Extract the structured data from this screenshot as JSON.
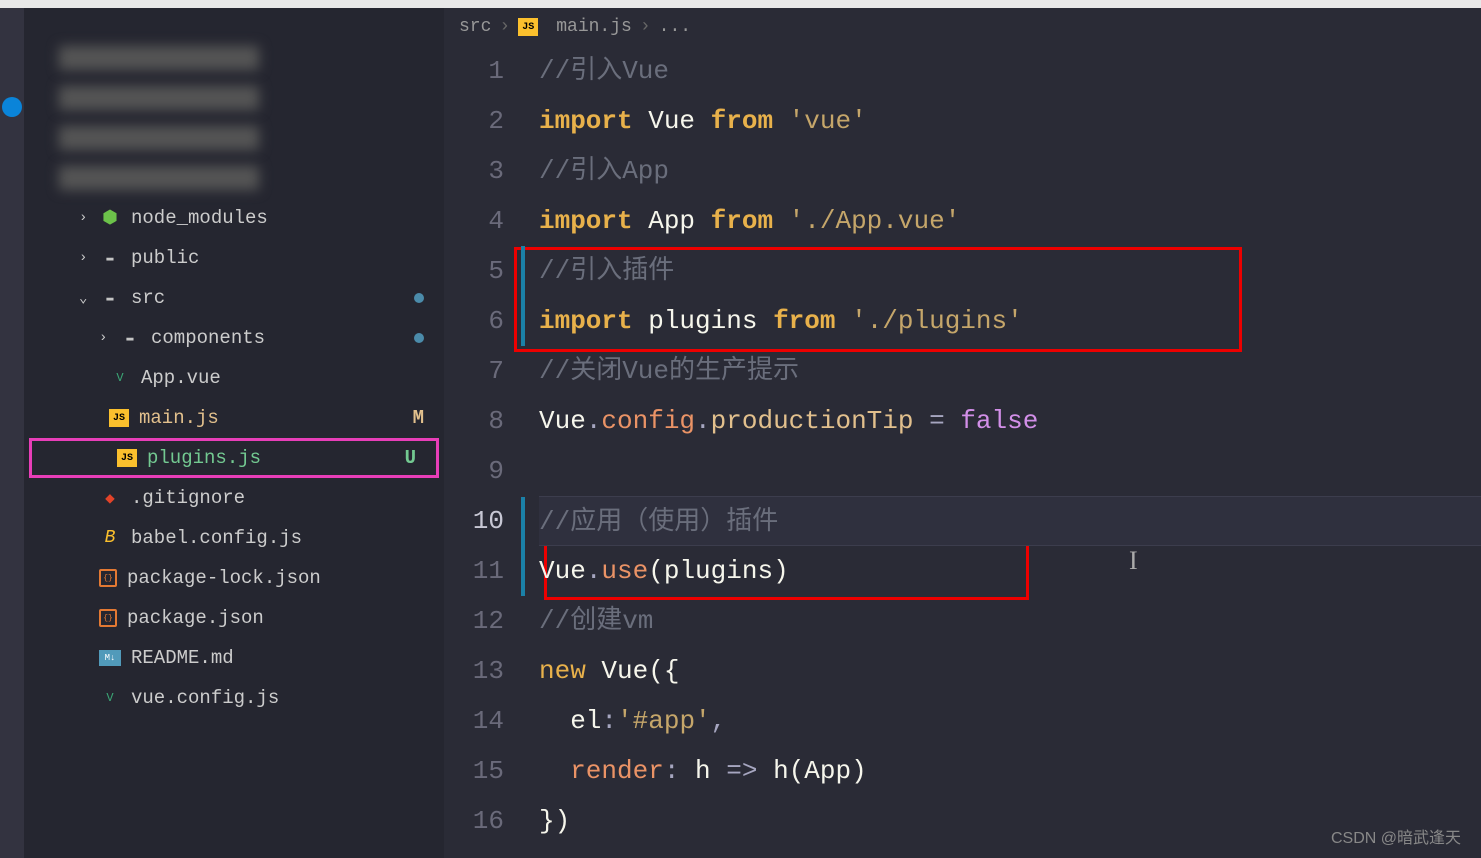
{
  "breadcrumb": {
    "part1": "src",
    "part2": "main.js",
    "part3": "...",
    "icon_label": "JS"
  },
  "sidebar": {
    "items": [
      {
        "type": "blurred"
      },
      {
        "type": "blurred"
      },
      {
        "type": "blurred"
      },
      {
        "type": "blurred"
      },
      {
        "type": "folder",
        "name": "node_modules",
        "chevron": "›",
        "icon": "nodejs",
        "indent": 1
      },
      {
        "type": "folder",
        "name": "public",
        "chevron": "›",
        "icon": "folder",
        "indent": 1
      },
      {
        "type": "folder",
        "name": "src",
        "chevron": "⌄",
        "icon": "folder",
        "indent": 1,
        "modified": true
      },
      {
        "type": "folder",
        "name": "components",
        "chevron": "›",
        "icon": "folder",
        "indent": 2,
        "modified": true
      },
      {
        "type": "file",
        "name": "App.vue",
        "icon": "vue",
        "indent": 3
      },
      {
        "type": "file",
        "name": "main.js",
        "icon": "js",
        "indent": 3,
        "git": "M",
        "git_class": "status-M"
      },
      {
        "type": "file",
        "name": "plugins.js",
        "icon": "js",
        "indent": 3,
        "git": "U",
        "git_class": "status-U",
        "highlight": true
      },
      {
        "type": "file",
        "name": ".gitignore",
        "icon": "git",
        "indent": 2
      },
      {
        "type": "file",
        "name": "babel.config.js",
        "icon": "babel",
        "indent": 2
      },
      {
        "type": "file",
        "name": "package-lock.json",
        "icon": "json",
        "indent": 2
      },
      {
        "type": "file",
        "name": "package.json",
        "icon": "json",
        "indent": 2
      },
      {
        "type": "file",
        "name": "README.md",
        "icon": "md",
        "indent": 2
      },
      {
        "type": "file",
        "name": "vue.config.js",
        "icon": "vue",
        "indent": 2
      }
    ]
  },
  "code": {
    "lines": [
      {
        "num": "1",
        "tokens": [
          {
            "cls": "tk-comment",
            "t": "//引入Vue"
          }
        ]
      },
      {
        "num": "2",
        "tokens": [
          {
            "cls": "tk-keyword",
            "t": "import"
          },
          {
            "cls": "tk-ident",
            "t": " Vue "
          },
          {
            "cls": "tk-from",
            "t": "from"
          },
          {
            "cls": "tk-string",
            "t": " 'vue'"
          }
        ]
      },
      {
        "num": "3",
        "tokens": [
          {
            "cls": "tk-comment",
            "t": "//引入App"
          }
        ]
      },
      {
        "num": "4",
        "tokens": [
          {
            "cls": "tk-keyword",
            "t": "import"
          },
          {
            "cls": "tk-ident",
            "t": " App "
          },
          {
            "cls": "tk-from",
            "t": "from"
          },
          {
            "cls": "tk-string",
            "t": " './App.vue'"
          }
        ]
      },
      {
        "num": "5",
        "tokens": [
          {
            "cls": "tk-comment",
            "t": "//引入插件"
          }
        ],
        "modified": true
      },
      {
        "num": "6",
        "tokens": [
          {
            "cls": "tk-keyword",
            "t": "import"
          },
          {
            "cls": "tk-ident",
            "t": " plugins "
          },
          {
            "cls": "tk-from",
            "t": "from"
          },
          {
            "cls": "tk-string",
            "t": " './plugins'"
          }
        ],
        "modified": true
      },
      {
        "num": "7",
        "tokens": [
          {
            "cls": "tk-comment",
            "t": "//关闭Vue的生产提示"
          }
        ]
      },
      {
        "num": "8",
        "tokens": [
          {
            "cls": "tk-ident",
            "t": "Vue"
          },
          {
            "cls": "tk-op",
            "t": "."
          },
          {
            "cls": "tk-prop",
            "t": "config"
          },
          {
            "cls": "tk-op",
            "t": "."
          },
          {
            "cls": "tk-prop2",
            "t": "productionTip"
          },
          {
            "cls": "tk-op",
            "t": " = "
          },
          {
            "cls": "tk-false",
            "t": "false"
          }
        ]
      },
      {
        "num": "9",
        "tokens": []
      },
      {
        "num": "10",
        "tokens": [
          {
            "cls": "tk-comment",
            "t": "//应用（使用）插件"
          }
        ],
        "current": true,
        "modified": true
      },
      {
        "num": "11",
        "tokens": [
          {
            "cls": "tk-ident",
            "t": "Vue"
          },
          {
            "cls": "tk-op",
            "t": "."
          },
          {
            "cls": "tk-prop",
            "t": "use"
          },
          {
            "cls": "tk-paren",
            "t": "("
          },
          {
            "cls": "tk-ident",
            "t": "plugins"
          },
          {
            "cls": "tk-paren",
            "t": ")"
          }
        ],
        "modified": true
      },
      {
        "num": "12",
        "tokens": [
          {
            "cls": "tk-comment",
            "t": "//创建vm"
          }
        ]
      },
      {
        "num": "13",
        "tokens": [
          {
            "cls": "tk-new",
            "t": "new"
          },
          {
            "cls": "tk-ident",
            "t": " Vue"
          },
          {
            "cls": "tk-paren",
            "t": "({"
          }
        ]
      },
      {
        "num": "14",
        "tokens": [
          {
            "cls": "tk-ident",
            "t": "  el"
          },
          {
            "cls": "tk-op",
            "t": ":"
          },
          {
            "cls": "tk-string",
            "t": "'#app'"
          },
          {
            "cls": "tk-op",
            "t": ","
          }
        ]
      },
      {
        "num": "15",
        "tokens": [
          {
            "cls": "tk-prop",
            "t": "  render"
          },
          {
            "cls": "tk-op",
            "t": ": "
          },
          {
            "cls": "tk-ident",
            "t": "h"
          },
          {
            "cls": "tk-arrow",
            "t": " => "
          },
          {
            "cls": "tk-ident",
            "t": "h"
          },
          {
            "cls": "tk-paren",
            "t": "("
          },
          {
            "cls": "tk-ident",
            "t": "App"
          },
          {
            "cls": "tk-paren",
            "t": ")"
          }
        ]
      },
      {
        "num": "16",
        "tokens": [
          {
            "cls": "tk-paren",
            "t": "})"
          }
        ]
      }
    ]
  },
  "watermark": "CSDN @暗武逢天",
  "icon_text": {
    "js": "JS",
    "md": "M↓",
    "json": "{}",
    "babel": "B",
    "vue": "V",
    "git": "◆",
    "nodejs": "⬢",
    "folder": "▬"
  }
}
